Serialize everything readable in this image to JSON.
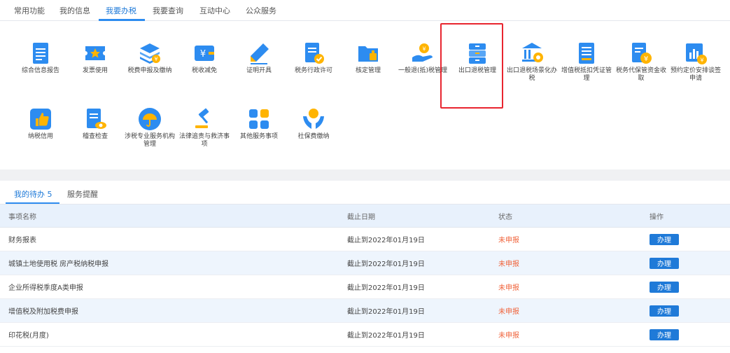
{
  "top_tabs": [
    "常用功能",
    "我的信息",
    "我要办税",
    "我要查询",
    "互动中心",
    "公众服务"
  ],
  "functions_row1": [
    {
      "label": "综合信息报告",
      "icon": "document-icon"
    },
    {
      "label": "发票使用",
      "icon": "invoice-star-icon"
    },
    {
      "label": "税费申报及缴纳",
      "icon": "stacked-layers-icon"
    },
    {
      "label": "税收减免",
      "icon": "yen-ticket-icon"
    },
    {
      "label": "证明开具",
      "icon": "pen-icon"
    },
    {
      "label": "税务行政许可",
      "icon": "document-check-icon"
    },
    {
      "label": "核定管理",
      "icon": "folder-stamp-icon"
    },
    {
      "label": "一般退(抵)税管理",
      "icon": "hand-coin-icon"
    },
    {
      "label": "出口退税管理",
      "icon": "cabinet-icon"
    },
    {
      "label": "出口退税场景化办税",
      "icon": "bank-gear-icon"
    },
    {
      "label": "增值税抵扣凭证管理",
      "icon": "receipt-icon"
    },
    {
      "label": "税务代保管资金收取",
      "icon": "document-yen-icon"
    },
    {
      "label": "预约定价安排谈签申请",
      "icon": "chart-yen-icon"
    }
  ],
  "functions_row2": [
    {
      "label": "纳税信用",
      "icon": "thumbs-up-icon"
    },
    {
      "label": "稽查检查",
      "icon": "document-eye-icon"
    },
    {
      "label": "涉税专业服务机构管理",
      "icon": "umbrella-icon"
    },
    {
      "label": "法律追责与救济事项",
      "icon": "gavel-icon"
    },
    {
      "label": "其他服务事项",
      "icon": "grid-apps-icon"
    },
    {
      "label": "社保费缴纳",
      "icon": "hands-globe-icon"
    }
  ],
  "sub_tabs": [
    "我的待办 5",
    "服务提醒"
  ],
  "table": {
    "headers": [
      "事项名称",
      "截止日期",
      "状态",
      "操作"
    ],
    "rows": [
      {
        "name": "财务报表",
        "deadline": "截止到2022年01月19日",
        "status": "未申报",
        "action": "办理"
      },
      {
        "name": "城镇土地使用税 房产税纳税申报",
        "deadline": "截止到2022年01月19日",
        "status": "未申报",
        "action": "办理"
      },
      {
        "name": "企业所得税季度A类申报",
        "deadline": "截止到2022年01月19日",
        "status": "未申报",
        "action": "办理"
      },
      {
        "name": "增值税及附加税费申报",
        "deadline": "截止到2022年01月19日",
        "status": "未申报",
        "action": "办理"
      },
      {
        "name": "印花税(月度)",
        "deadline": "截止到2022年01月19日",
        "status": "未申报",
        "action": "办理"
      }
    ]
  },
  "colors": {
    "accent": "#1f7ad8",
    "status": "#f0643c",
    "highlight": "#e8252f"
  }
}
